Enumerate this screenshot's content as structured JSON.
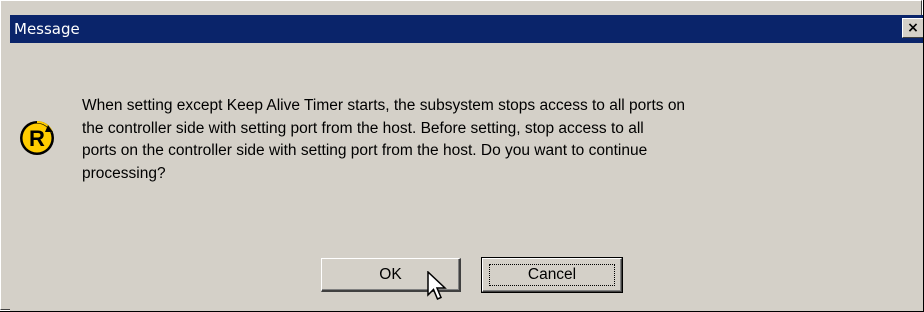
{
  "window": {
    "title": "Message",
    "close_label": "×",
    "icon": "r-confirmation-icon",
    "icon_letter": "R"
  },
  "message": {
    "line1": "When setting except Keep Alive Timer starts, the subsystem stops access to all ports on",
    "line2": "the controller side with setting port from the host. Before setting, stop access to all",
    "line3": "ports on the controller side with setting port from the host. Do you want to continue",
    "line4": "processing?"
  },
  "buttons": {
    "ok_label": "OK",
    "cancel_label": "Cancel"
  },
  "colors": {
    "title_bar": "#0a246a",
    "dialog_face": "#d4d0c8",
    "icon_fill": "#ffcc00"
  },
  "cursor": "arrow-pointer-icon"
}
